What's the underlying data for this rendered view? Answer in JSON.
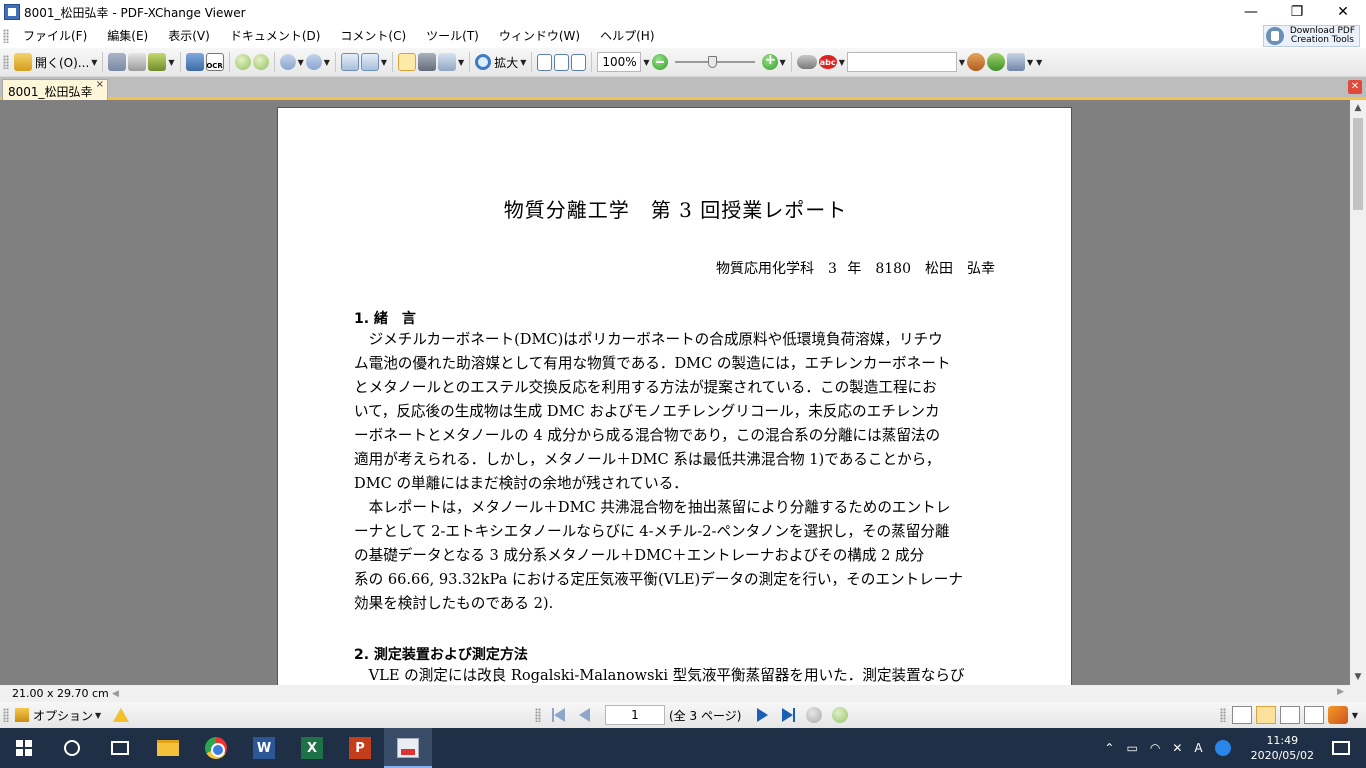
{
  "window": {
    "title": "8001_松田弘幸 - PDF-XChange Viewer",
    "minimize_glyph": "—",
    "restore_glyph": "❐",
    "close_glyph": "✕"
  },
  "menu": {
    "items": [
      "ファイル(F)",
      "編集(E)",
      "表示(V)",
      "ドキュメント(D)",
      "コメント(C)",
      "ツール(T)",
      "ウィンドウ(W)",
      "ヘルプ(H)"
    ],
    "download_line1": "Download PDF",
    "download_line2": "Creation Tools"
  },
  "toolbar": {
    "open_label": "開く(O)...",
    "ocr_label": "OCR",
    "zoom_label": "拡大",
    "zoom_value": "100%",
    "slider_level_percent": 47,
    "search_value": ""
  },
  "tabs": {
    "doc_tab_label": "8001_松田弘幸",
    "tab_close_glyph": "×",
    "panel_close_glyph": "✕"
  },
  "document": {
    "title": "物質分離工学　第 3 回授業レポート",
    "author": "物質応用化学科　3 年　8180　松田　弘幸",
    "section1_heading": "1. 緒　言",
    "section1_lines": [
      "　ジメチルカーボネート(DMC)はポリカーボネートの合成原料や低環境負荷溶媒，リチウ",
      "ム電池の優れた助溶媒として有用な物質である．DMC の製造には，エチレンカーボネート",
      "とメタノールとのエステル交換反応を利用する方法が提案されている．この製造工程にお",
      "いて，反応後の生成物は生成 DMC およびモノエチレングリコール，未反応のエチレンカ",
      "ーボネートとメタノールの 4 成分から成る混合物であり，この混合系の分離には蒸留法の",
      "適用が考えられる．しかし，メタノール＋DMC 系は最低共沸混合物 1)であることから，",
      "DMC の単離にはまだ検討の余地が残されている．",
      "　本レポートは，メタノール＋DMC 共沸混合物を抽出蒸留により分離するためのエントレ",
      "ーナとして 2-エトキシエタノールならびに 4-メチル-2-ペンタノンを選択し，その蒸留分離",
      "の基礎データとなる 3 成分系メタノール＋DMC＋エントレーナおよびその構成 2 成分",
      "系の 66.66, 93.32kPa における定圧気液平衡(VLE)データの測定を行い，そのエントレーナ",
      "効果を検討したものである 2)."
    ],
    "section2_heading": "2. 測定装置および測定方法",
    "section2_lines": [
      "　VLE の測定には改良 Rogalski-Malanowski 型気液平衡蒸留器を用いた．測定装置ならび"
    ]
  },
  "status": {
    "page_size": "21.00 x 29.70 cm",
    "options_label": "オプション",
    "current_page": "1",
    "page_total": "(全 3 ページ)"
  },
  "taskbar": {
    "time": "11:49",
    "date": "2020/05/02",
    "ime": "A",
    "word_letter": "W",
    "excel_letter": "X",
    "ppt_letter": "P"
  }
}
